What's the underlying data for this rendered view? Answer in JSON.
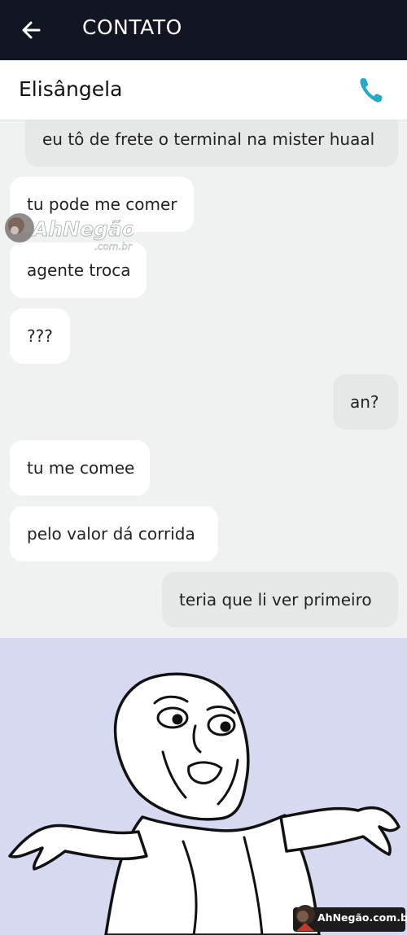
{
  "header": {
    "title": "CONTATO",
    "back_icon": "arrow-left-icon"
  },
  "contact": {
    "name": "Elisângela",
    "call_icon": "phone-icon",
    "call_icon_color": "#26a8c6"
  },
  "messages": [
    {
      "direction": "out",
      "text": "eu tô de frete o terminal na mister huaal"
    },
    {
      "direction": "in",
      "text": "tu pode me comer"
    },
    {
      "direction": "in",
      "text": "agente troca"
    },
    {
      "direction": "in",
      "text": "???"
    },
    {
      "direction": "out",
      "text": "an?"
    },
    {
      "direction": "in",
      "text": "tu me comee"
    },
    {
      "direction": "in",
      "text": "pelo valor dá corrida"
    },
    {
      "direction": "out",
      "text": "teria que li ver primeiro"
    }
  ],
  "watermark": {
    "brand": "AhNegão!",
    "domain": ".com.br"
  },
  "footer_badge": {
    "text": "AhNegão.com.br"
  },
  "colors": {
    "topbar": "#111622",
    "chat_bg": "#eff2f1",
    "incoming_bubble": "#ffffff",
    "outgoing_bubble": "#e5e8e7",
    "meme_bg": "#d6d9ef"
  }
}
